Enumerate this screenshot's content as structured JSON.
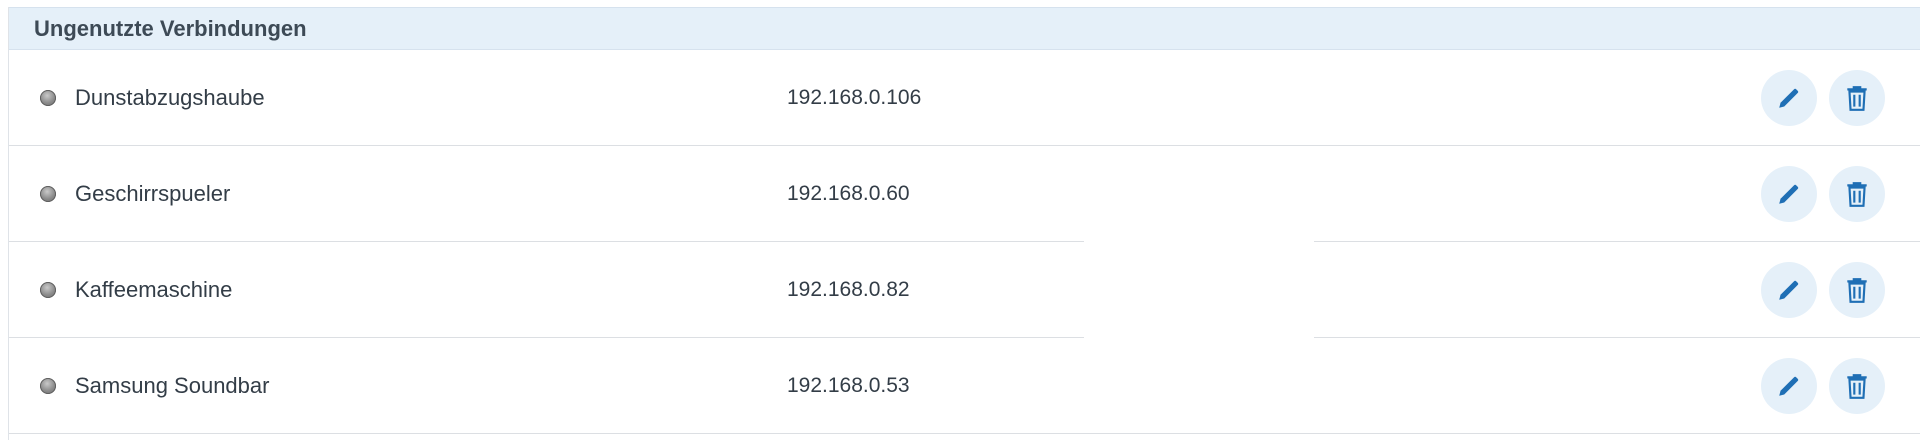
{
  "section": {
    "title": "Ungenutzte Verbindungen"
  },
  "connections": [
    {
      "name": "Dunstabzugshaube",
      "ip": "192.168.0.106",
      "status_icon": "gray-status-dot",
      "edit_icon": "pencil-icon",
      "delete_icon": "trash-icon"
    },
    {
      "name": "Geschirrspueler",
      "ip": "192.168.0.60",
      "status_icon": "gray-status-dot",
      "edit_icon": "pencil-icon",
      "delete_icon": "trash-icon"
    },
    {
      "name": "Kaffeemaschine",
      "ip": "192.168.0.82",
      "status_icon": "gray-status-dot",
      "edit_icon": "pencil-icon",
      "delete_icon": "trash-icon"
    },
    {
      "name": "Samsung Soundbar",
      "ip": "192.168.0.53",
      "status_icon": "gray-status-dot",
      "edit_icon": "pencil-icon",
      "delete_icon": "trash-icon"
    }
  ],
  "colors": {
    "header_bg": "#e5f0f9",
    "icon_blue": "#1f6fb5",
    "status_gray": "#8a8a8a"
  }
}
